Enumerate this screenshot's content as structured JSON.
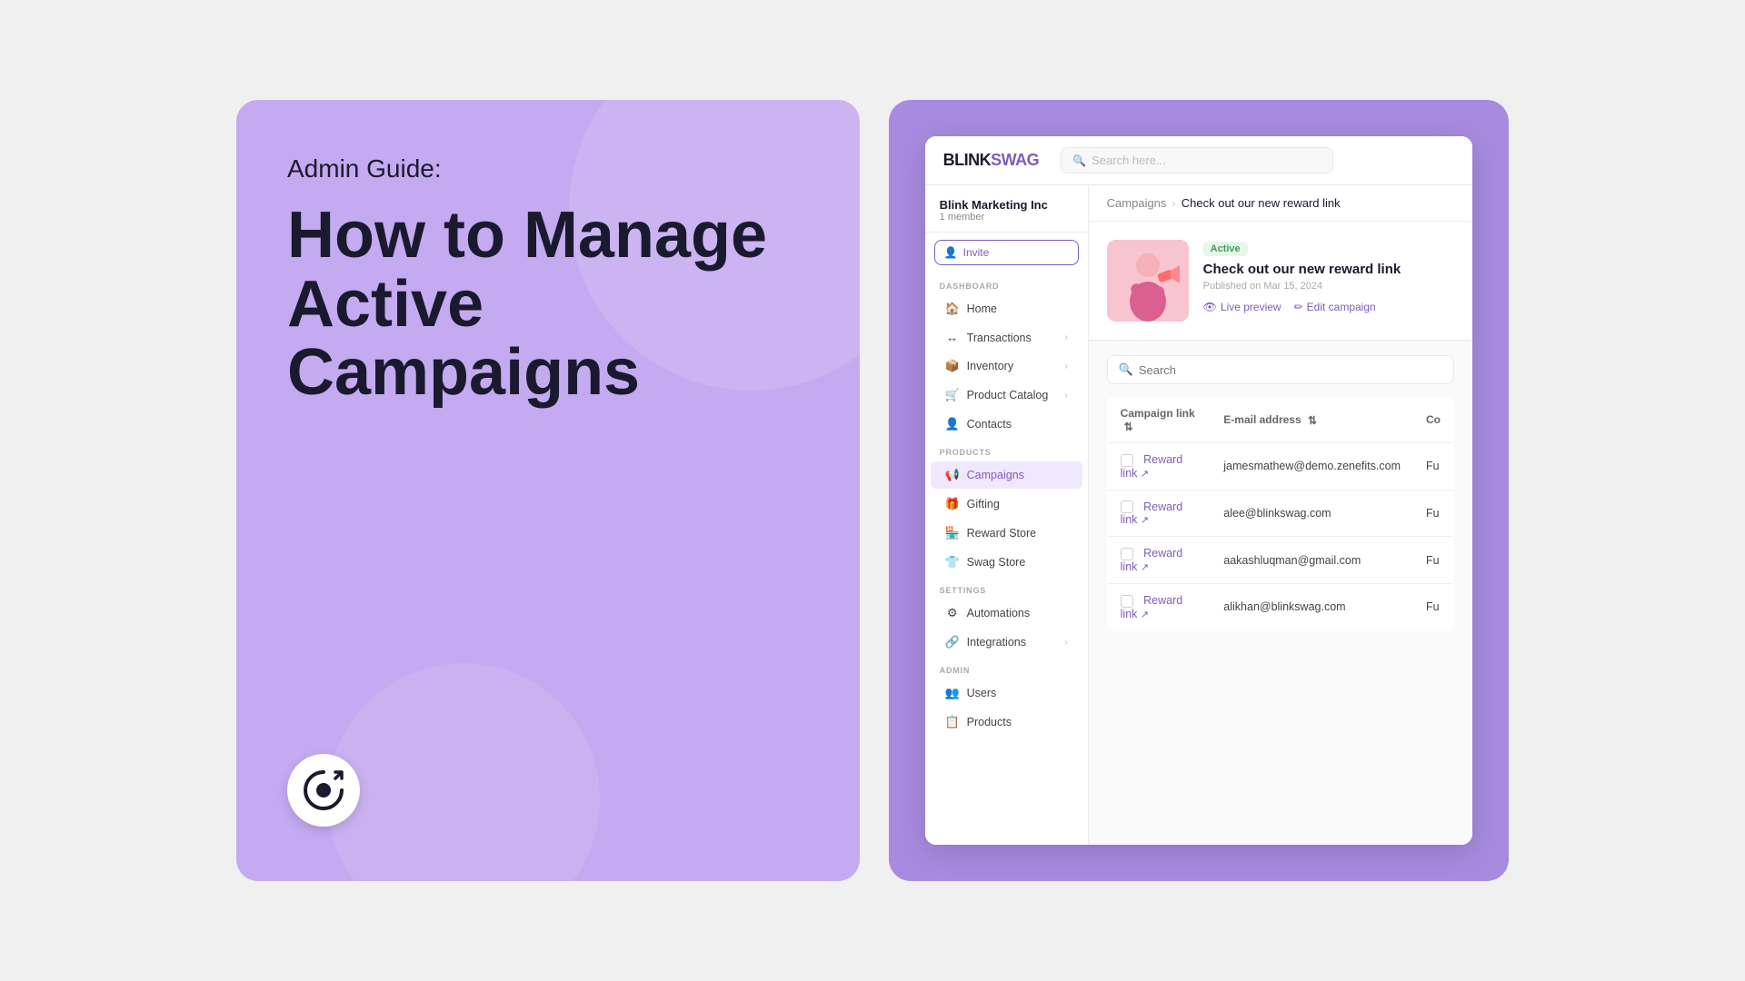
{
  "left": {
    "admin_guide": "Admin Guide:",
    "title_line1": "How to Manage",
    "title_line2": "Active Campaigns"
  },
  "app": {
    "logo_blink": "BLINK",
    "logo_swag": "SWAG",
    "search_placeholder": "Search here...",
    "org": {
      "name": "Blink Marketing Inc",
      "member_count": "1 member"
    },
    "invite_label": "Invite",
    "sidebar": {
      "dashboard_section": "DASHBOARD",
      "dashboard_items": [
        {
          "label": "Home",
          "icon": "🏠",
          "has_chevron": false
        },
        {
          "label": "Transactions",
          "icon": "↔",
          "has_chevron": true
        },
        {
          "label": "Inventory",
          "icon": "📦",
          "has_chevron": true
        },
        {
          "label": "Product Catalog",
          "icon": "🛒",
          "has_chevron": true
        },
        {
          "label": "Contacts",
          "icon": "👤",
          "has_chevron": false
        }
      ],
      "products_section": "PRODUCTS",
      "products_items": [
        {
          "label": "Campaigns",
          "icon": "📢",
          "has_chevron": false,
          "active": true
        },
        {
          "label": "Gifting",
          "icon": "🎁",
          "has_chevron": false
        },
        {
          "label": "Reward Store",
          "icon": "🏪",
          "has_chevron": false
        },
        {
          "label": "Swag Store",
          "icon": "👕",
          "has_chevron": false
        }
      ],
      "settings_section": "SETTINGS",
      "settings_items": [
        {
          "label": "Automations",
          "icon": "⚙",
          "has_chevron": false
        },
        {
          "label": "Integrations",
          "icon": "🔗",
          "has_chevron": true
        }
      ],
      "admin_section": "ADMIN",
      "admin_items": [
        {
          "label": "Users",
          "icon": "👥",
          "has_chevron": false
        },
        {
          "label": "Products",
          "icon": "📋",
          "has_chevron": false
        }
      ]
    },
    "breadcrumb": {
      "parent": "Campaigns",
      "current": "Check out our new reward link"
    },
    "campaign": {
      "status": "Active",
      "title": "Check out our new reward link",
      "date": "Published on Mar 15, 2024",
      "action_preview": "Live preview",
      "action_edit": "Edit campaign"
    },
    "table": {
      "search_placeholder": "Search",
      "columns": [
        "Campaign link",
        "E-mail address",
        "Co"
      ],
      "rows": [
        {
          "campaign_link": "Reward link",
          "email": "jamesmathew@demo.zenefits.com",
          "col3": "Fu"
        },
        {
          "campaign_link": "Reward link",
          "email": "alee@blinkswag.com",
          "col3": "Fu"
        },
        {
          "campaign_link": "Reward link",
          "email": "aakashluqman@gmail.com",
          "col3": "Fu"
        },
        {
          "campaign_link": "Reward link",
          "email": "alikhan@blinkswag.com",
          "col3": "Fu"
        }
      ]
    }
  }
}
